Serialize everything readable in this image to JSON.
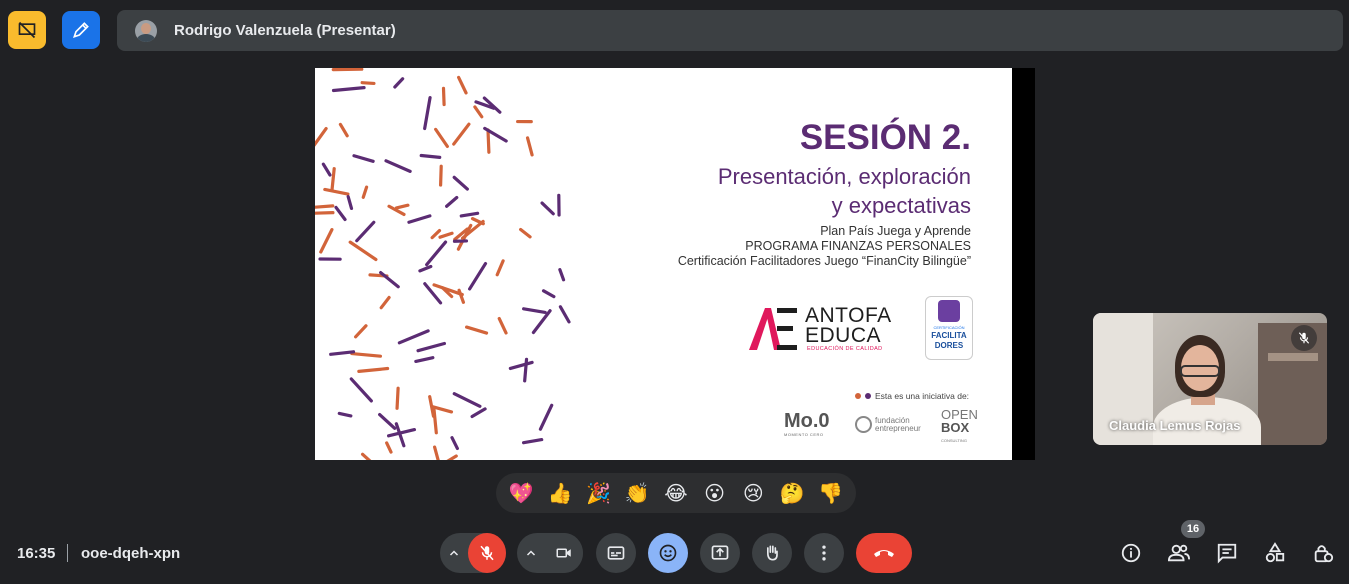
{
  "header": {
    "presenter_name": "Rodrigo Valenzuela (Presentar)"
  },
  "slide": {
    "title": "SESIÓN 2.",
    "subtitle_line1": "Presentación, exploración",
    "subtitle_line2": "y expectativas",
    "info_line1": "Plan País Juega y Aprende",
    "info_line2": "PROGRAMA FINANZAS PERSONALES",
    "info_line3": "Certificación Facilitadores Juego “FinanCity Bilingüe”",
    "logo_antofa_1": "ANTOFA",
    "logo_antofa_2": "EDUCA",
    "logo_antofa_tag": "EDUCACIÓN DE CALIDAD",
    "logo_fac_small": "CERTIFICACIÓN",
    "logo_fac_1": "FACILITA",
    "logo_fac_2": "DORES",
    "initiative_text": "Esta es una iniciativa de:",
    "logo_moo": "Mo.0",
    "logo_moo_sub": "MOMENTO CERO",
    "logo_fund_1": "fundación",
    "logo_fund_2": "entrepreneur",
    "logo_open_1": "OPEN",
    "logo_open_2": "BOX",
    "logo_open_3": "CONSULTING",
    "colors": {
      "purple": "#5b2c73",
      "orange": "#d2643a",
      "magenta": "#e0185c"
    }
  },
  "participant": {
    "name": "Claudia Lemus Rojas"
  },
  "reactions": [
    "💖",
    "👍",
    "🎉",
    "👏",
    "😂",
    "😮",
    "😢",
    "🤔",
    "👎"
  ],
  "footer": {
    "time": "16:35",
    "meeting_code": "ooe-dqeh-xpn",
    "participants_count": "16"
  },
  "colors": {
    "background": "#202124",
    "control": "#3c4043",
    "danger": "#ea4335",
    "accent": "#8ab4f8"
  }
}
